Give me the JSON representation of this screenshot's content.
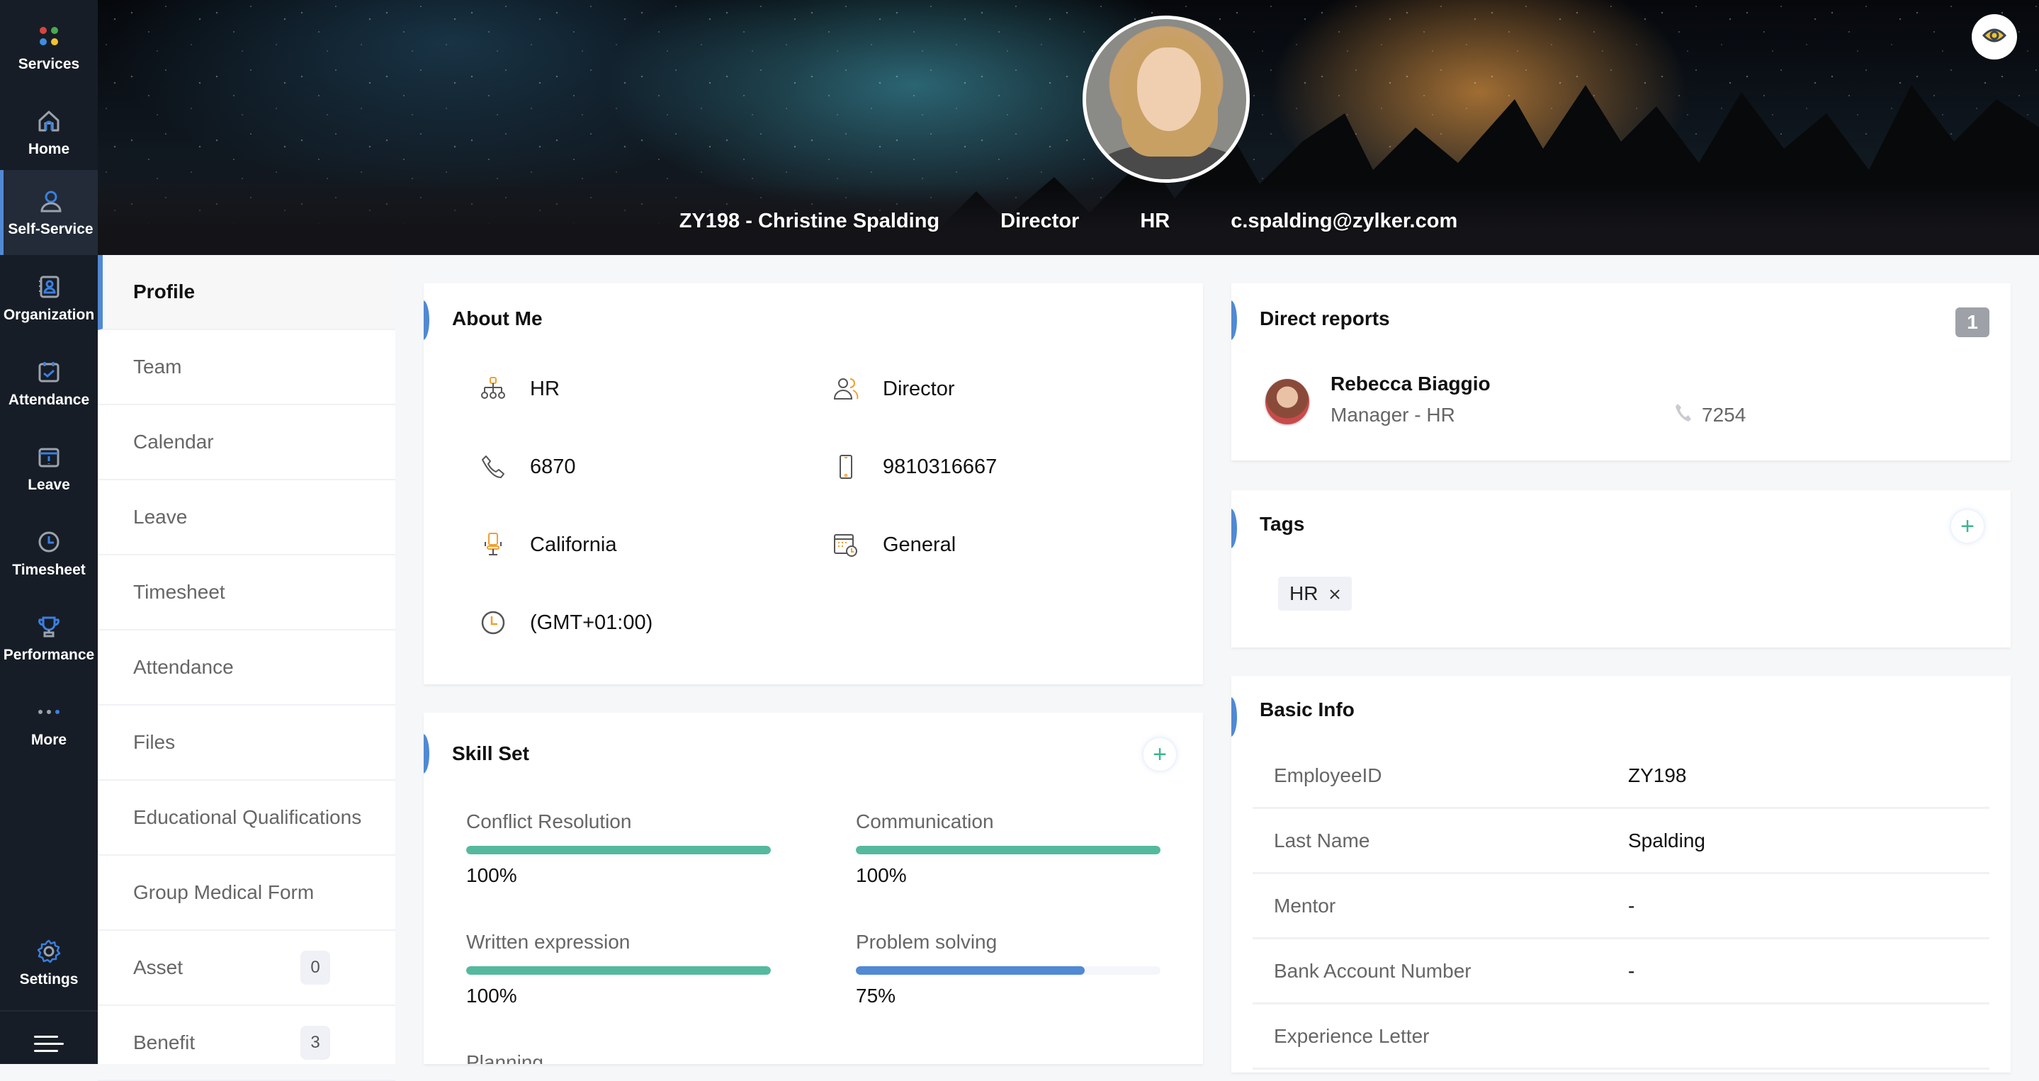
{
  "rail": {
    "items": [
      {
        "label": "Services",
        "icon": "services-dots-icon"
      },
      {
        "label": "Home",
        "icon": "home-icon"
      },
      {
        "label": "Self-Service",
        "icon": "person-icon",
        "active": true
      },
      {
        "label": "Organization",
        "icon": "contact-book-icon"
      },
      {
        "label": "Attendance",
        "icon": "calendar-check-icon"
      },
      {
        "label": "Leave",
        "icon": "leave-icon"
      },
      {
        "label": "Timesheet",
        "icon": "clock-icon"
      },
      {
        "label": "Performance",
        "icon": "trophy-icon"
      },
      {
        "label": "More",
        "icon": "more-dots-icon"
      }
    ],
    "settings_label": "Settings"
  },
  "header": {
    "employee": "ZY198 - Christine Spalding",
    "designation": "Director",
    "department": "HR",
    "email": "c.spalding@zylker.com"
  },
  "subnav": {
    "items": [
      {
        "label": "Profile",
        "active": true
      },
      {
        "label": "Team"
      },
      {
        "label": "Calendar"
      },
      {
        "label": "Leave"
      },
      {
        "label": "Timesheet"
      },
      {
        "label": "Attendance"
      },
      {
        "label": "Files"
      },
      {
        "label": "Educational Qualifications"
      },
      {
        "label": "Group Medical Form"
      },
      {
        "label": "Asset",
        "count": "0"
      },
      {
        "label": "Benefit",
        "count": "3"
      }
    ]
  },
  "about": {
    "title": "About Me",
    "department": "HR",
    "designation": "Director",
    "extension": "6870",
    "mobile": "9810316667",
    "location": "California",
    "shift": "General",
    "timezone": "(GMT+01:00)"
  },
  "skills": {
    "title": "Skill Set",
    "items": [
      {
        "name": "Conflict Resolution",
        "percent": 100,
        "label": "100%",
        "color": "#55b99e"
      },
      {
        "name": "Communication",
        "percent": 100,
        "label": "100%",
        "color": "#55b99e"
      },
      {
        "name": "Written expression",
        "percent": 100,
        "label": "100%",
        "color": "#55b99e"
      },
      {
        "name": "Problem solving",
        "percent": 75,
        "label": "75%",
        "color": "#5089d4"
      },
      {
        "name": "Planning"
      }
    ]
  },
  "direct_reports": {
    "title": "Direct reports",
    "count": "1",
    "items": [
      {
        "name": "Rebecca Biaggio",
        "role": "Manager - HR",
        "extension": "7254"
      }
    ]
  },
  "tags": {
    "title": "Tags",
    "items": [
      "HR"
    ]
  },
  "basic_info": {
    "title": "Basic Info",
    "rows": [
      {
        "label": "EmployeeID",
        "value": "ZY198"
      },
      {
        "label": "Last Name",
        "value": "Spalding"
      },
      {
        "label": "Mentor",
        "value": "-"
      },
      {
        "label": "Bank Account Number",
        "value": "-"
      },
      {
        "label": "Experience Letter",
        "value": ""
      }
    ]
  },
  "colors": {
    "accent": "#5089d4",
    "success": "#55b99e",
    "rail_bg": "#171d26"
  }
}
